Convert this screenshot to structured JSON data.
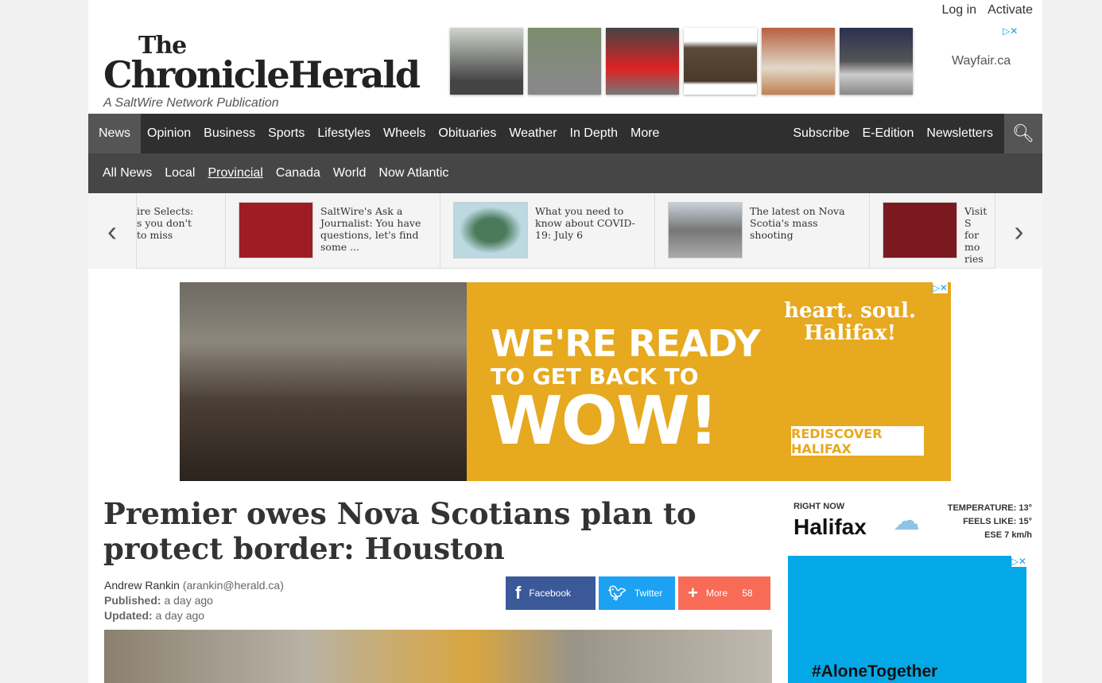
{
  "top": {
    "login": "Log in",
    "activate": "Activate"
  },
  "logo": {
    "the": "The",
    "name": "ChronicleHerald",
    "tagline": "A SaltWire Network Publication"
  },
  "top_ad": {
    "advertiser": "Wayfair.ca"
  },
  "nav": {
    "items": [
      "News",
      "Opinion",
      "Business",
      "Sports",
      "Lifestyles",
      "Wheels",
      "Obituaries",
      "Weather",
      "In Depth",
      "More"
    ],
    "right": [
      "Subscribe",
      "E-Edition",
      "Newsletters"
    ]
  },
  "subnav": [
    "All News",
    "Local",
    "Provincial",
    "Canada",
    "World",
    "Now Atlantic"
  ],
  "carousel": [
    "ire Selects: s you don't to miss",
    "SaltWire's Ask a Journalist: You have questions, let's find some ...",
    "What you need to know about COVID-19: July 6",
    "The latest on Nova Scotia's mass shooting",
    "Visit S for mo ries y"
  ],
  "banner": {
    "line1": "WE'RE READY",
    "line2": "TO GET BACK TO",
    "line3": "WOW!",
    "slogan1": "heart. soul.",
    "slogan2": "Halifax!",
    "cta": "REDISCOVER HALIFAX"
  },
  "article": {
    "headline": "Premier owes Nova Scotians plan to protect border: Houston",
    "author": "Andrew Rankin",
    "email": "(arankin@herald.ca)",
    "published_label": "Published:",
    "published": "a day ago",
    "updated_label": "Updated:",
    "updated": "a day ago"
  },
  "share": {
    "facebook": "Facebook",
    "twitter": "Twitter",
    "more": "More",
    "count": "58"
  },
  "weather": {
    "label": "RIGHT NOW",
    "city": "Halifax",
    "temp": "TEMPERATURE: 13°",
    "feels": "FEELS LIKE: 15°",
    "wind": "ESE 7 km/h"
  },
  "side_ad": {
    "text": "#AloneTogether"
  }
}
